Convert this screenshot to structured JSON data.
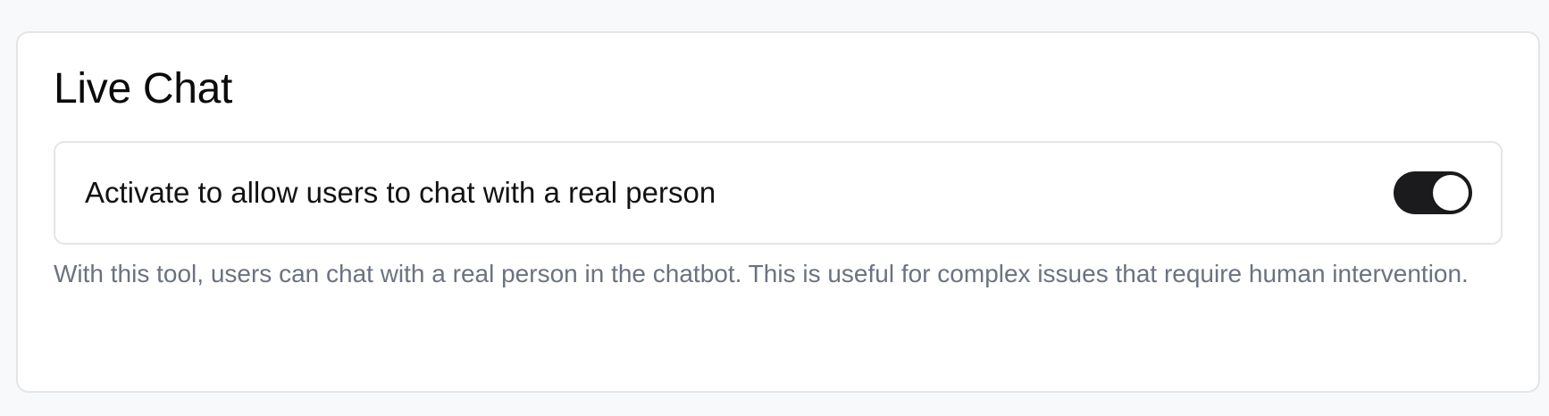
{
  "live_chat": {
    "title": "Live Chat",
    "setting": {
      "label": "Activate to allow users to chat with a real person",
      "enabled": true
    },
    "description": "With this tool, users can chat with a real person in the chatbot. This is useful for complex issues that require human intervention."
  },
  "colors": {
    "toggle_on": "#1b1b1d",
    "description_text": "#6b7280",
    "border": "#e3e5e8"
  }
}
